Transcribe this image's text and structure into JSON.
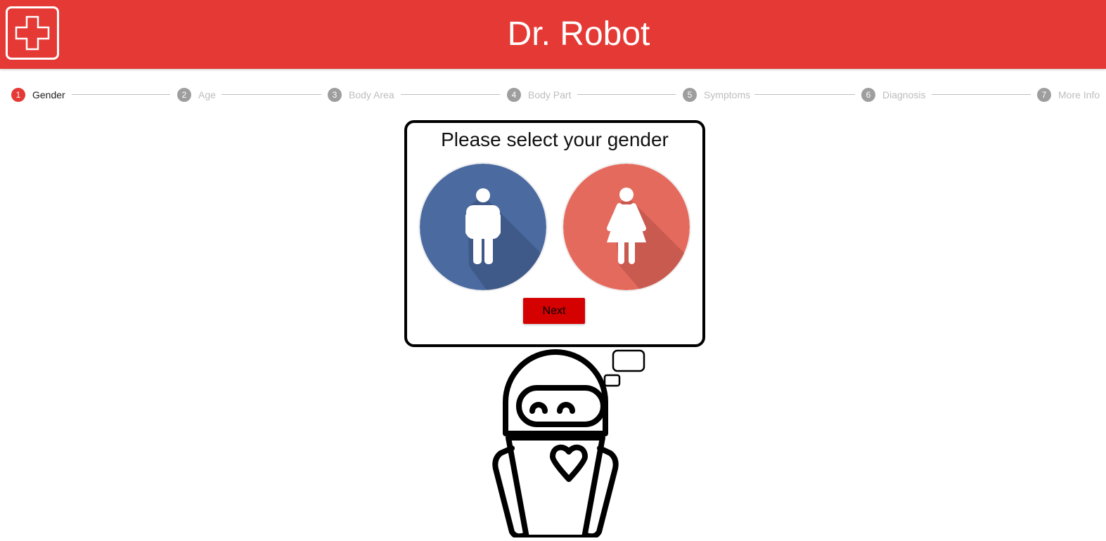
{
  "header": {
    "title": "Dr. Robot",
    "logo_icon": "medical-cross-icon",
    "background_color": "#e53935"
  },
  "stepper": {
    "active_step": 1,
    "steps": [
      {
        "number": "1",
        "label": "Gender"
      },
      {
        "number": "2",
        "label": "Age"
      },
      {
        "number": "3",
        "label": "Body Area"
      },
      {
        "number": "4",
        "label": "Body Part"
      },
      {
        "number": "5",
        "label": "Symptoms"
      },
      {
        "number": "6",
        "label": "Diagnosis"
      },
      {
        "number": "7",
        "label": "More Info"
      }
    ]
  },
  "card": {
    "title": "Please select your gender",
    "options": [
      {
        "name": "male",
        "icon": "male-figure-icon",
        "color": "#4a6aa0"
      },
      {
        "name": "female",
        "icon": "female-figure-icon",
        "color": "#e56a5e"
      }
    ],
    "next_label": "Next",
    "next_color": "#d50000"
  },
  "illustration": {
    "icon": "robot-icon",
    "speech_icon": "thought-bubble-icon"
  }
}
